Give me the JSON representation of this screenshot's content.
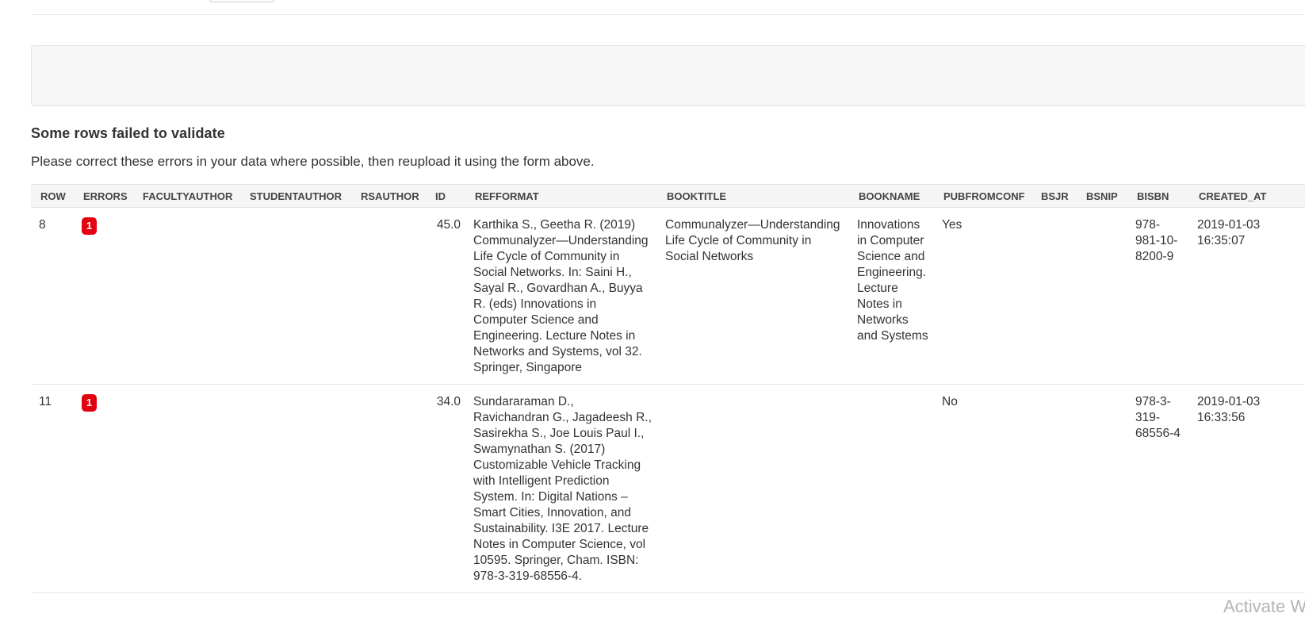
{
  "validation": {
    "title": "Some rows failed to validate",
    "message": "Please correct these errors in your data where possible, then reupload it using the form above."
  },
  "table": {
    "headers": [
      "ROW",
      "ERRORS",
      "FACULTYAUTHOR",
      "STUDENTAUTHOR",
      "RSAUTHOR",
      "ID",
      "REFFORMAT",
      "BOOKTITLE",
      "BOOKNAME",
      "PUBFROMCONF",
      "BSJR",
      "BSNIP",
      "BISBN",
      "CREATED_AT"
    ],
    "rows": [
      {
        "row": "8",
        "errors": "1",
        "facultyauthor": "",
        "studentauthor": "",
        "rsauthor": "",
        "id": "45.0",
        "refformat": "Karthika S., Geetha R. (2019) Communalyzer—Understanding Life Cycle of Community in Social Networks. In: Saini H., Sayal R., Govardhan A., Buyya R. (eds) Innovations in Computer Science and Engineering. Lecture Notes in Networks and Systems, vol 32. Springer, Singapore",
        "booktitle": "Communalyzer—Understanding Life Cycle of Community in Social Networks",
        "bookname": "Innovations in Computer Science and Engineering. Lecture Notes in Networks and Systems",
        "pubfromconf": "Yes",
        "bsjr": "",
        "bsnip": "",
        "bisbn": "978-981-10-8200-9",
        "created_at": "2019-01-03 16:35:07"
      },
      {
        "row": "11",
        "errors": "1",
        "facultyauthor": "",
        "studentauthor": "",
        "rsauthor": "",
        "id": "34.0",
        "refformat": "Sundararaman D., Ravichandran G., Jagadeesh R., Sasirekha S., Joe Louis Paul I., Swamynathan S. (2017) Customizable Vehicle Tracking with Intelligent Prediction System. In: Digital Nations – Smart Cities, Innovation, and Sustainability. I3E 2017. Lecture Notes in Computer Science, vol 10595. Springer, Cham. ISBN: 978-3-319-68556-4.",
        "booktitle": "",
        "bookname": "",
        "pubfromconf": "No",
        "bsjr": "",
        "bsnip": "",
        "bisbn": "978-3-319-68556-4",
        "created_at": "2019-01-03 16:33:56"
      }
    ]
  },
  "watermark": "Activate W",
  "colors": {
    "error_badge": "#e3000f",
    "header_bg": "#f5f5f5",
    "well_bg": "#f6f6f6"
  }
}
